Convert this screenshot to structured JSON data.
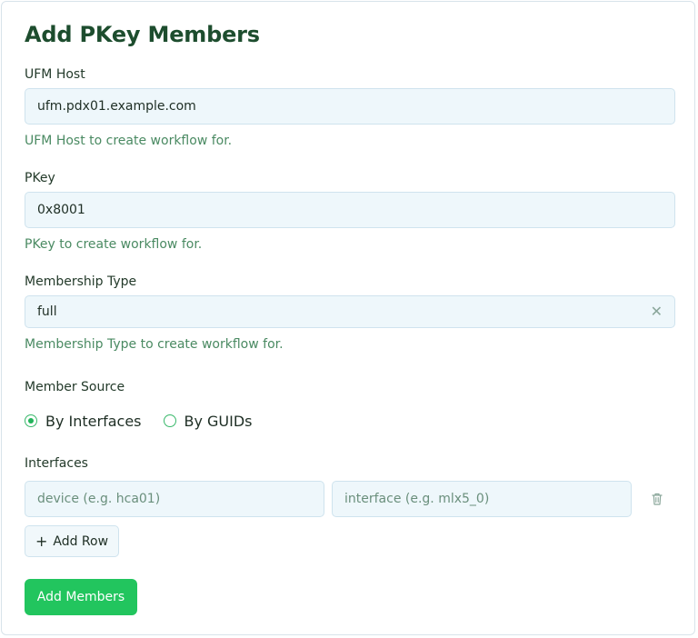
{
  "form": {
    "title": "Add PKey Members",
    "ufm_host": {
      "label": "UFM Host",
      "value": "ufm.pdx01.example.com",
      "help": "UFM Host to create workflow for."
    },
    "pkey": {
      "label": "PKey",
      "value": "0x8001",
      "help": "PKey to create workflow for."
    },
    "membership_type": {
      "label": "Membership Type",
      "value": "full",
      "clear_glyph": "✕",
      "help": "Membership Type to create workflow for."
    },
    "member_source": {
      "label": "Member Source",
      "options": [
        {
          "label": "By Interfaces",
          "selected": true
        },
        {
          "label": "By GUIDs",
          "selected": false
        }
      ]
    },
    "interfaces": {
      "label": "Interfaces",
      "rows": [
        {
          "device_placeholder": "device (e.g. hca01)",
          "interface_placeholder": "interface (e.g. mlx5_0)",
          "device_value": "",
          "interface_value": ""
        }
      ],
      "add_row_glyph": "+",
      "add_row_label": "Add Row",
      "delete_icon": "trash-icon"
    },
    "submit_label": "Add Members"
  },
  "colors": {
    "title": "#1d4d2e",
    "help_text": "#4a8a62",
    "input_bg": "#eef7fb",
    "input_border": "#cfe3ee",
    "primary": "#22c55e",
    "radio_accent": "#22b35a"
  }
}
